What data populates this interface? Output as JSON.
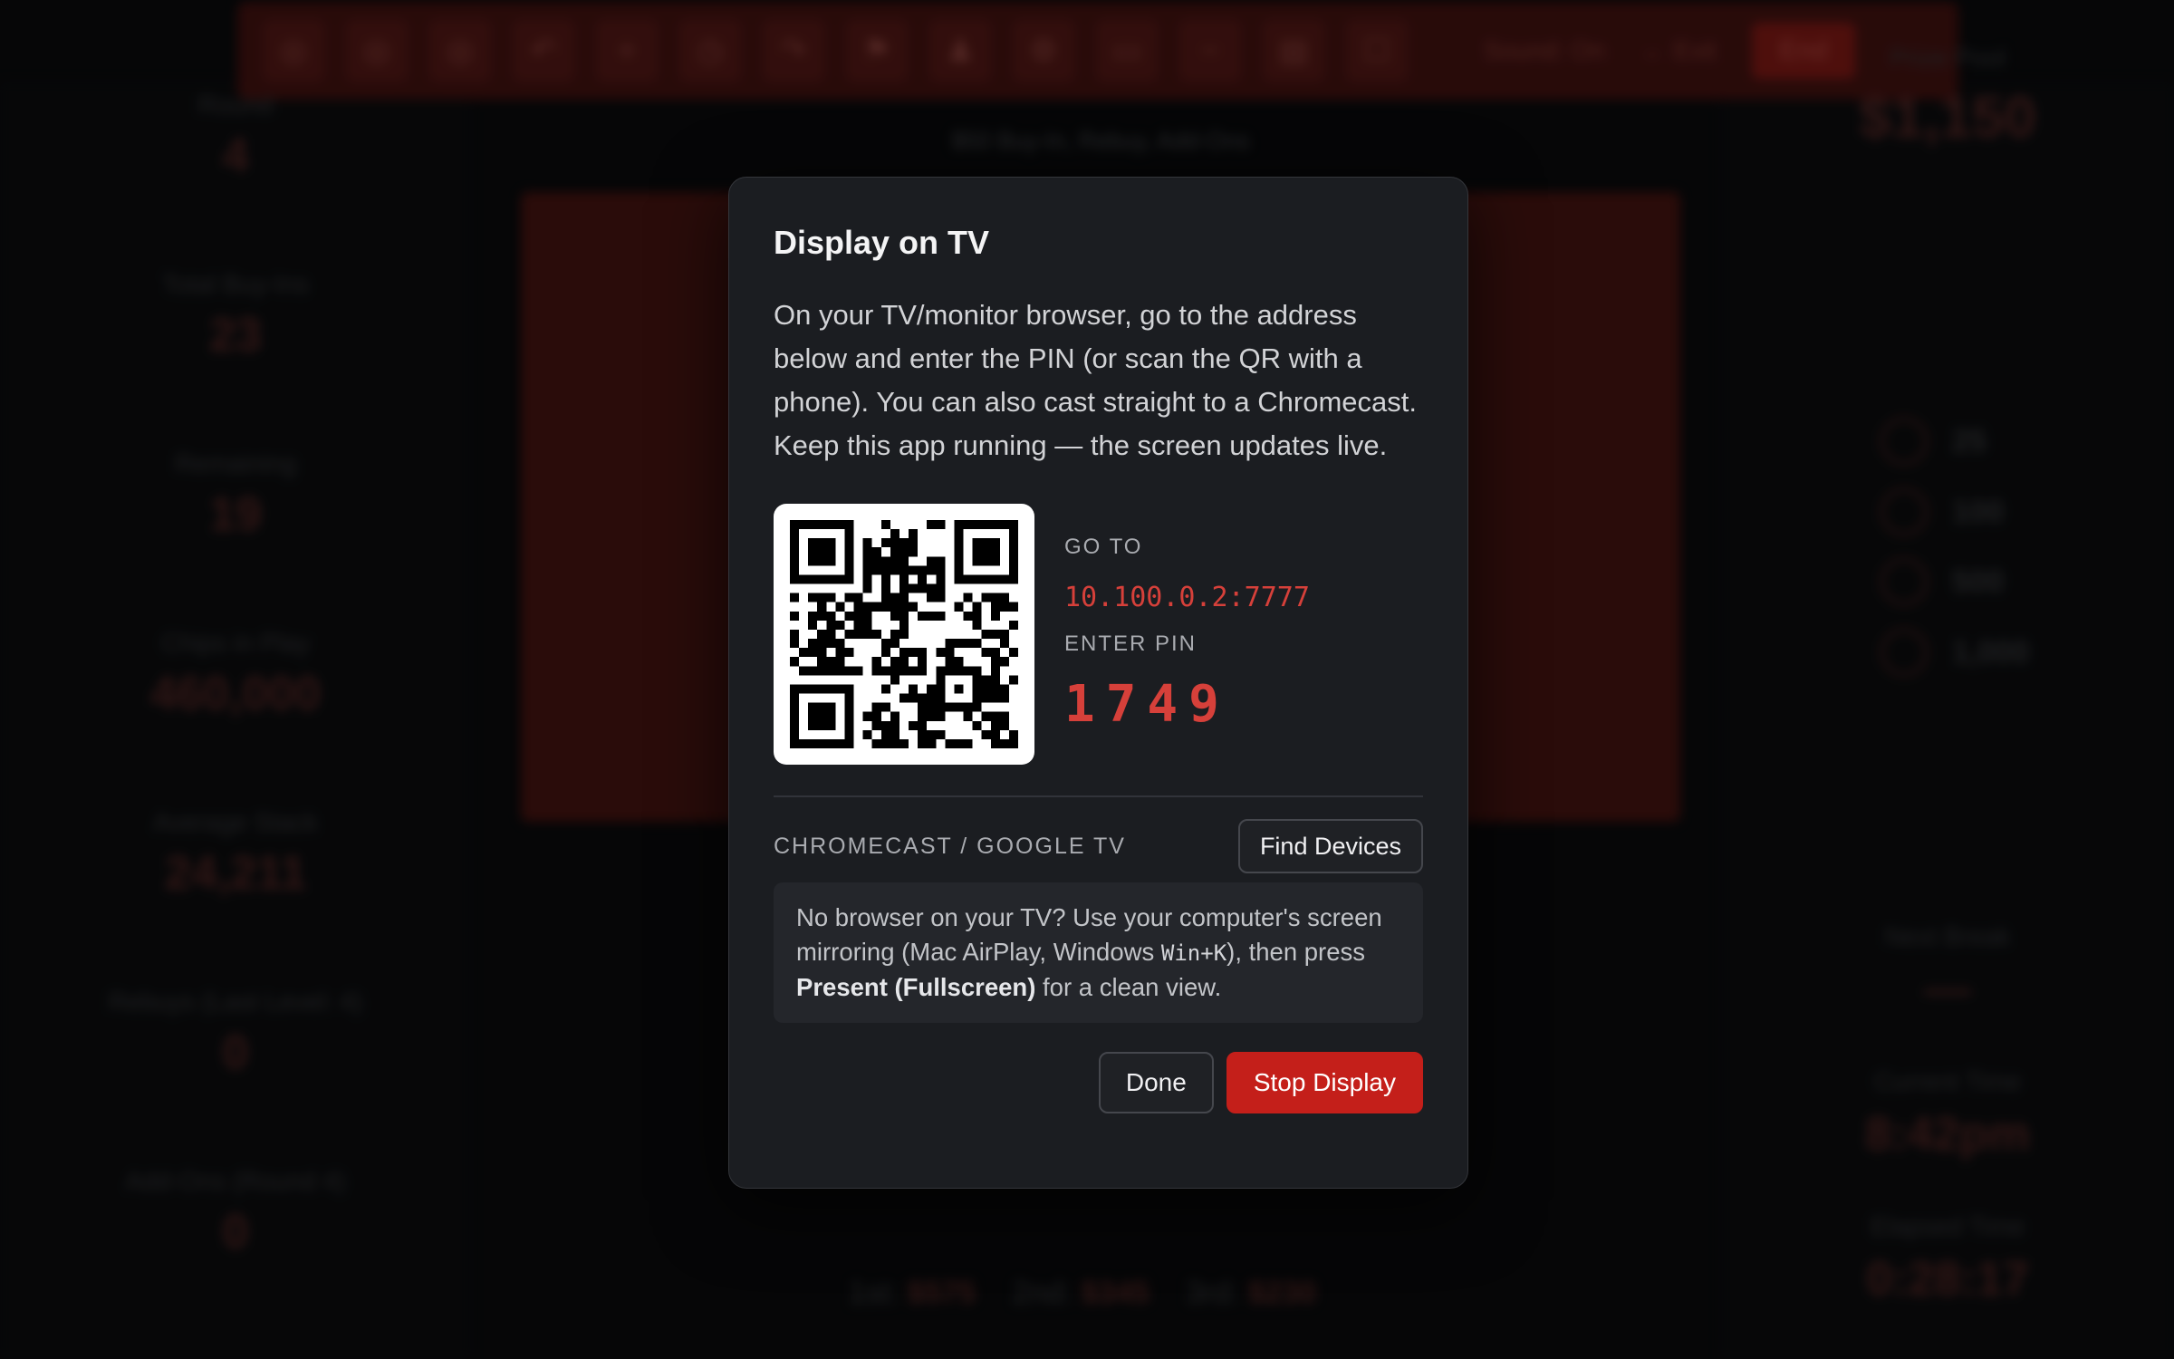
{
  "modal": {
    "title": "Display on TV",
    "description": "On your TV/monitor browser, go to the address below and enter the PIN (or scan the QR with a phone). You can also cast straight to a Chromecast. Keep this app running — the screen updates live.",
    "go_to_label": "GO TO",
    "address": "10.100.0.2:7777",
    "enter_pin_label": "ENTER PIN",
    "pin": "1749",
    "chromecast_label": "CHROMECAST / GOOGLE TV",
    "find_devices_label": "Find Devices",
    "hint": {
      "part1": "No browser on your TV? Use your computer's screen mirroring (Mac AirPlay, Windows ",
      "shortcut": "Win+K",
      "part2": "), then press ",
      "emphasis": "Present (Fullscreen)",
      "part3": " for a clean view."
    },
    "done_label": "Done",
    "stop_label": "Stop Display"
  },
  "background": {
    "toolbar": {
      "icons": [
        "chip-icon",
        "chip-icon",
        "chip-icon",
        "undo-icon",
        "plus-icon",
        "timer-icon",
        "redo-icon",
        "flag-icon",
        "users-icon",
        "gear-icon",
        "tv-icon",
        "minus-icon",
        "layout-icon",
        "fullscreen-icon"
      ],
      "sound_label": "Sound: On",
      "exit_label": "← Exit",
      "end_label": "End"
    },
    "subtitle": "$50 Buy-In, Rebuy, Add-Ons",
    "left_stats": [
      {
        "label": "Round",
        "value": "4"
      },
      {
        "label": "Total Buy-Ins",
        "value": "23"
      },
      {
        "label": "Remaining",
        "value": "19"
      },
      {
        "label": "Chips in Play",
        "value": "460,000"
      },
      {
        "label": "Average Stack",
        "value": "24,211"
      },
      {
        "label": "Rebuys (Last Level: 4)",
        "value": "0"
      },
      {
        "label": "Add-Ons (Round 4)",
        "value": "0"
      }
    ],
    "prize_pool": {
      "label": "Prize Pool",
      "value": "$1,150"
    },
    "chips": [
      "25",
      "100",
      "500",
      "1,000"
    ],
    "right_stats": [
      {
        "label": "Next Break",
        "value": "—"
      },
      {
        "label": "Current Time",
        "value": "8:42pm"
      },
      {
        "label": "Elapsed Time",
        "value": "0:28:17"
      }
    ],
    "payouts": [
      {
        "place": "1st:",
        "amount": "$575"
      },
      {
        "place": "2nd:",
        "amount": "$345"
      },
      {
        "place": "3rd:",
        "amount": "$230"
      }
    ]
  },
  "colors": {
    "accent_red": "#c41f1a",
    "address_red": "#d6403a",
    "modal_bg": "#1b1d21"
  }
}
